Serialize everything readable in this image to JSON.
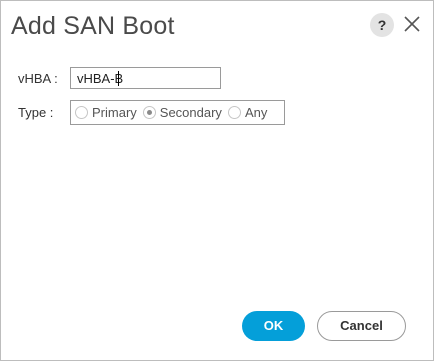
{
  "dialog": {
    "title": "Add SAN Boot",
    "help_icon": "help-icon",
    "close_icon": "close-icon"
  },
  "form": {
    "vhba_label": "vHBA :",
    "vhba_value": "vHBA-B",
    "type_label": "Type  :",
    "type_options": [
      {
        "label": "Primary",
        "checked": false
      },
      {
        "label": "Secondary",
        "checked": true
      },
      {
        "label": "Any",
        "checked": false
      }
    ]
  },
  "footer": {
    "ok_label": "OK",
    "cancel_label": "Cancel"
  },
  "colors": {
    "primary_button": "#049fd9",
    "title_text": "#4a4a4a"
  }
}
